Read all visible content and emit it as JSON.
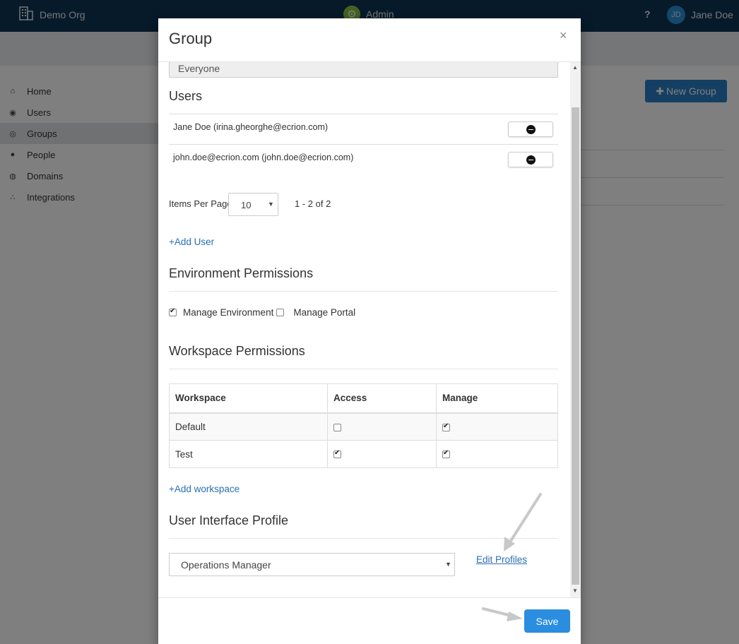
{
  "app": {
    "org_name": "Demo Org",
    "center_title": "Admin",
    "help_label": "?",
    "user_initials": "JD",
    "user_name": "Jane Doe"
  },
  "sidebar": {
    "items": [
      {
        "label": "Home",
        "icon": "home-icon"
      },
      {
        "label": "Users",
        "icon": "user-circle-icon"
      },
      {
        "label": "Groups",
        "icon": "group-icon",
        "active": true
      },
      {
        "label": "People",
        "icon": "people-icon"
      },
      {
        "label": "Domains",
        "icon": "globe-icon"
      },
      {
        "label": "Integrations",
        "icon": "share-nodes-icon"
      }
    ]
  },
  "page": {
    "new_group_label": "New Group"
  },
  "modal": {
    "title": "Group",
    "close_label": "×",
    "group_name_value": "Everyone",
    "users_heading": "Users",
    "users": [
      {
        "label": "Jane Doe (irina.gheorghe@ecrion.com)"
      },
      {
        "label": "john.doe@ecrion.com (john.doe@ecrion.com)"
      }
    ],
    "pagination": {
      "items_per_page_label": "Items Per Page",
      "items_per_page_value": "10",
      "range_text": "1 - 2 of 2"
    },
    "add_user_label": "+Add User",
    "env_permissions_heading": "Environment Permissions",
    "env_permissions": [
      {
        "label": "Manage Environment",
        "checked": true
      },
      {
        "label": "Manage Portal",
        "checked": false
      }
    ],
    "workspace_permissions_heading": "Workspace Permissions",
    "workspace_table": {
      "headers": [
        "Workspace",
        "Access",
        "Manage"
      ],
      "rows": [
        {
          "workspace": "Default",
          "access": false,
          "manage": true
        },
        {
          "workspace": "Test",
          "access": true,
          "manage": true
        }
      ]
    },
    "add_workspace_label": "+Add workspace",
    "ui_profile_heading": "User Interface Profile",
    "ui_profile_value": "Operations Manager",
    "edit_profiles_label": "Edit Profiles",
    "save_label": "Save"
  },
  "colors": {
    "topbar": "#0e3555",
    "primary_button": "#2a8de0",
    "link": "#2a6fb3",
    "admin_gear": "#8dc63f"
  }
}
